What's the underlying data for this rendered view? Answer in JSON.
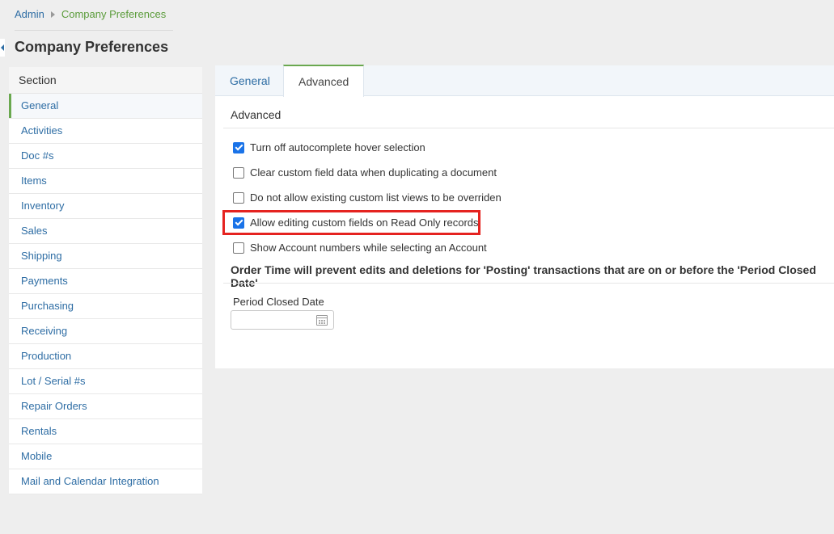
{
  "breadcrumb": {
    "root": "Admin",
    "current": "Company Preferences"
  },
  "page": {
    "title": "Company Preferences"
  },
  "sidebar": {
    "header": "Section",
    "items": [
      {
        "label": "General"
      },
      {
        "label": "Activities"
      },
      {
        "label": "Doc #s"
      },
      {
        "label": "Items"
      },
      {
        "label": "Inventory"
      },
      {
        "label": "Sales"
      },
      {
        "label": "Shipping"
      },
      {
        "label": "Payments"
      },
      {
        "label": "Purchasing"
      },
      {
        "label": "Receiving"
      },
      {
        "label": "Production"
      },
      {
        "label": "Lot / Serial #s"
      },
      {
        "label": "Repair Orders"
      },
      {
        "label": "Rentals"
      },
      {
        "label": "Mobile"
      },
      {
        "label": "Mail and Calendar Integration"
      }
    ]
  },
  "tabs": {
    "general": "General",
    "advanced": "Advanced"
  },
  "advanced": {
    "section_title": "Advanced",
    "options": [
      {
        "label": "Turn off autocomplete hover selection",
        "checked": true
      },
      {
        "label": "Clear custom field data when duplicating a document",
        "checked": false
      },
      {
        "label": "Do not allow existing custom list views to be overriden",
        "checked": false
      },
      {
        "label": "Allow editing custom fields on Read Only records",
        "checked": true
      },
      {
        "label": "Show Account numbers while selecting an Account",
        "checked": false
      }
    ],
    "notice": "Order Time will prevent edits and deletions for 'Posting' transactions that are on or before the 'Period Closed Date'",
    "period_closed_label": "Period Closed Date",
    "period_closed_value": ""
  },
  "colors": {
    "accent_green": "#6aa84f",
    "link_blue": "#2e6da4",
    "highlight_red": "#e52320",
    "checkbox_blue": "#1a73e8"
  },
  "icons": {
    "calendar": "calendar-icon",
    "collapse": "collapse-arrow-icon",
    "breadcrumb_sep": "chevron-right-icon"
  }
}
